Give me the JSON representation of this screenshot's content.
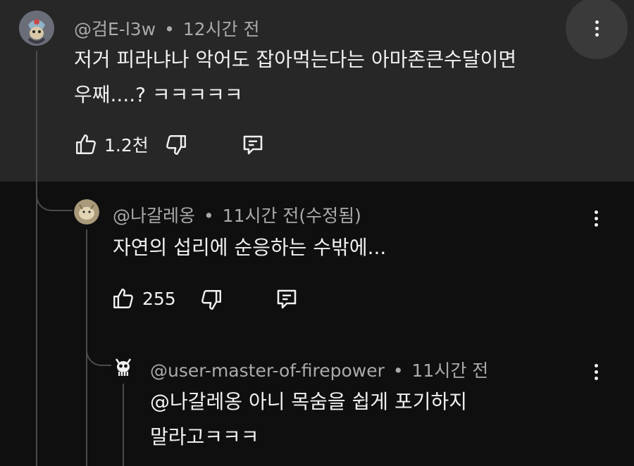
{
  "comments": [
    {
      "author": "@검E-l3w",
      "time": "12시간 전",
      "lines": [
        "저거 피라냐나 악어도 잡아먹는다는 아마존큰수달이면",
        "우째....? ㅋㅋㅋㅋㅋ"
      ],
      "likes": "1.2천"
    },
    {
      "author": "@나갈레옹",
      "time": "11시간 전(수정됨)",
      "lines": [
        "자연의 섭리에 순응하는 수밖에..."
      ],
      "likes": "255"
    },
    {
      "author": "@user-master-of-firepower",
      "time": "11시간 전",
      "lines": [
        "@나갈레옹 아니 목숨을 쉽게 포기하지",
        "말라고ㅋㅋㅋ"
      ]
    }
  ],
  "separator": "•",
  "icons": {
    "like": "thumbs-up-icon",
    "dislike": "thumbs-down-icon",
    "reply": "comment-icon",
    "menu": "more-vertical-icon"
  },
  "colors": {
    "background": "#0f0f0f",
    "highlight": "#272727",
    "text": "#f1f1f1",
    "meta": "#aaaaaa"
  }
}
